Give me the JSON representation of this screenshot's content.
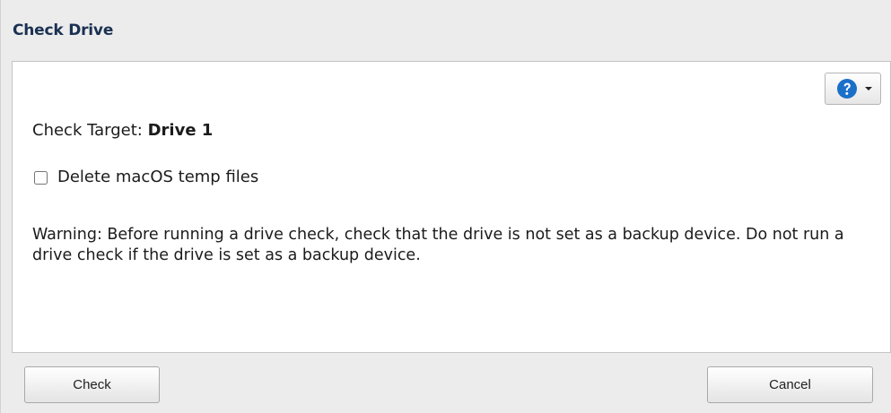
{
  "dialog": {
    "title": "Check Drive"
  },
  "help": {
    "icon": "question-circle-icon",
    "icon_color": "#1a6fc9"
  },
  "target": {
    "label": "Check Target:",
    "value": "Drive 1"
  },
  "options": {
    "delete_macos_temp": {
      "label": "Delete macOS temp files",
      "checked": false
    }
  },
  "warning": {
    "text": "Warning: Before running a drive check, check that the drive is not set as a backup device. Do not run a drive check if the drive is set as a backup device."
  },
  "buttons": {
    "check": "Check",
    "cancel": "Cancel"
  }
}
